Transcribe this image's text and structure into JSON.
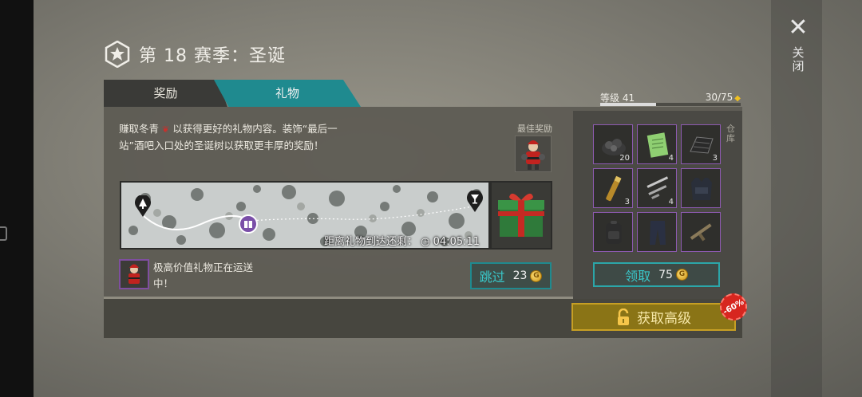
{
  "season_title": "第 18 赛季：圣诞",
  "close": {
    "label": "关闭"
  },
  "tabs": [
    {
      "label": "奖励",
      "active": false
    },
    {
      "label": "礼物",
      "active": true
    }
  ],
  "description": {
    "part1": "赚取冬青",
    "part2": "以获得更好的礼物内容。装饰“最后一站”酒吧入口处的圣诞树以获取更丰厚的奖励！"
  },
  "best_reward": {
    "label": "最佳奖励",
    "icon": "santa-figure-icon"
  },
  "countdown": {
    "label": "距离礼物到达还剩：",
    "time": "04:05:11"
  },
  "notice": {
    "text": "极高价值礼物正在运送中！"
  },
  "skip": {
    "label": "跳过",
    "cost": "23"
  },
  "level": {
    "label": "等级 41",
    "progress_text": "30/75",
    "fraction": 0.4
  },
  "storage_label": "仓库",
  "inventory": [
    {
      "icon": "coal-pile-icon",
      "count": "20"
    },
    {
      "icon": "green-notebook-icon",
      "count": "4"
    },
    {
      "icon": "metal-sheet-icon",
      "count": "3"
    },
    {
      "icon": "flare-stick-icon",
      "count": "3"
    },
    {
      "icon": "gun-parts-icon",
      "count": "4"
    },
    {
      "icon": "tactical-vest-icon",
      "count": ""
    },
    {
      "icon": "backpack-icon",
      "count": ""
    },
    {
      "icon": "tactical-pants-icon",
      "count": ""
    },
    {
      "icon": "rifle-icon",
      "count": ""
    }
  ],
  "claim": {
    "label": "领取",
    "cost": "75"
  },
  "premium": {
    "label": "获取高级",
    "discount": "-60%"
  },
  "colors": {
    "teal": "#1f8a8f",
    "gold": "#c79f24",
    "purple": "#8d5ab0"
  }
}
